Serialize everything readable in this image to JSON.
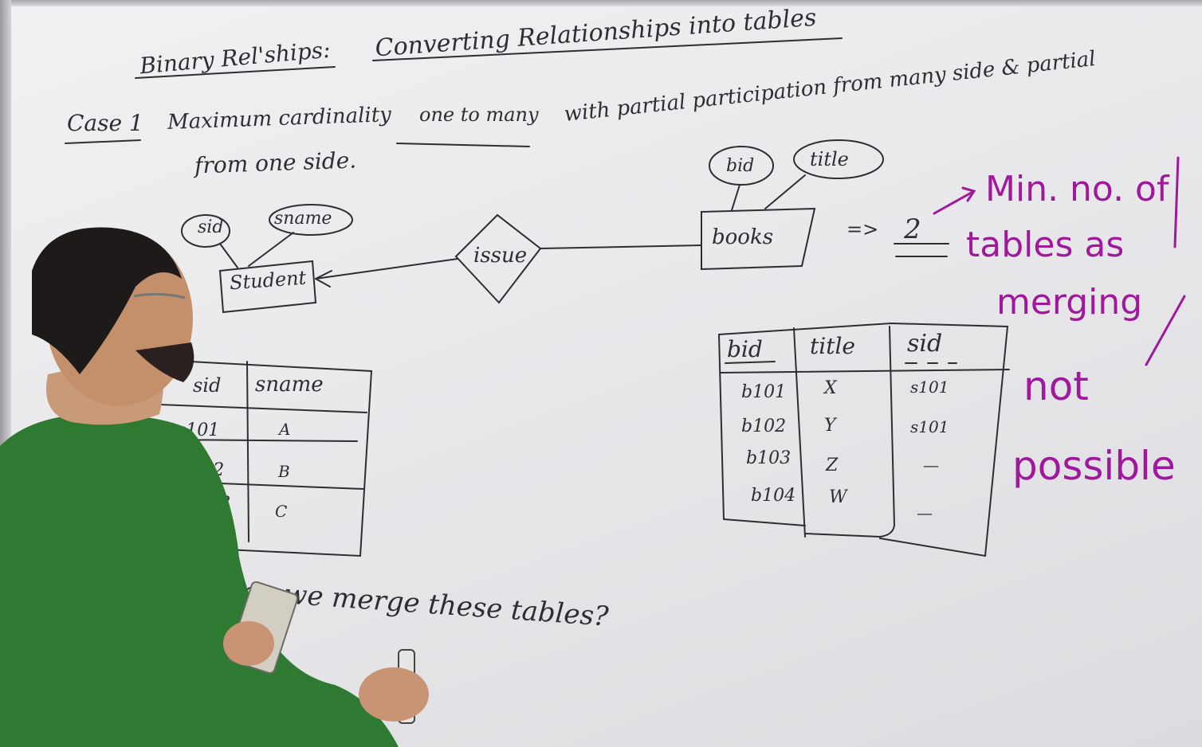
{
  "board": {
    "heading": "Binary Rel'ships:",
    "title": "Converting Relationships into tables",
    "case_label": "Case 1",
    "case_text_line1": "Maximum cardinality",
    "case_one_to_many": "one to many",
    "case_text_line1b": "with partial participation from many side & partial",
    "case_text_line2": "from one side."
  },
  "er_diagram": {
    "entity_student": "Student",
    "attr_sid": "sid",
    "attr_sname": "sname",
    "relationship": "issue",
    "entity_books": "books",
    "attr_bid": "bid",
    "attr_title": "title",
    "arrow_result": "=>",
    "result_value": "2"
  },
  "student_table": {
    "headers": [
      "sid",
      "sname"
    ],
    "rows": [
      [
        "s101",
        "A"
      ],
      [
        "s102",
        "B"
      ],
      [
        "s103",
        "C"
      ]
    ]
  },
  "books_table": {
    "headers": [
      "bid",
      "title",
      "sid"
    ],
    "rows": [
      [
        "b101",
        "X",
        "s101"
      ],
      [
        "b102",
        "Y",
        "s101"
      ],
      [
        "b103",
        "Z",
        "—"
      ],
      [
        "b104",
        "W",
        "—"
      ]
    ]
  },
  "question": "can we merge these tables?",
  "annotation": {
    "line1": "Min. no. of",
    "line2": "tables as",
    "line3": "merging",
    "line4": "not",
    "line5": "possible",
    "color": "#a0189c"
  },
  "scene": {
    "person": "instructor",
    "shirt_color": "#2f7a32",
    "held_items": [
      "duster",
      "marker"
    ]
  }
}
